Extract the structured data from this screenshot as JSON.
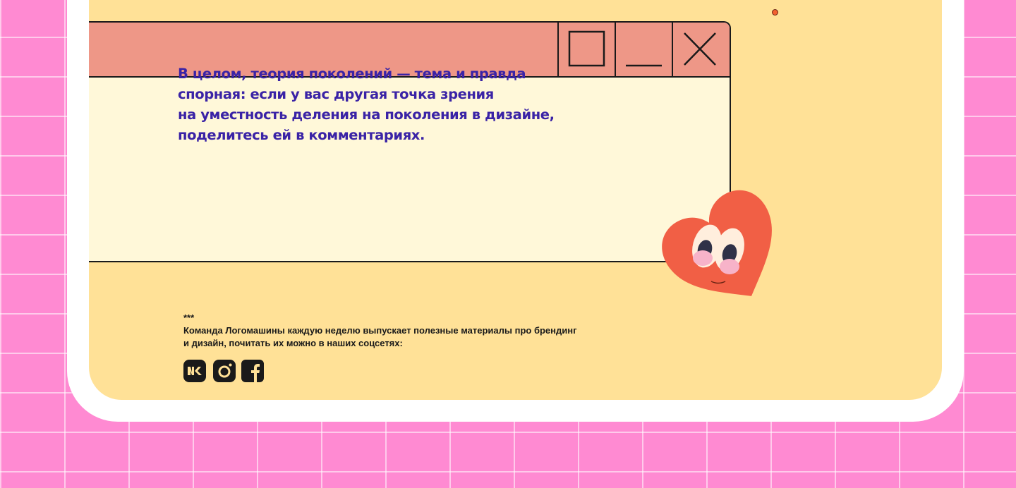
{
  "colors": {
    "background": "#ff8ad2",
    "panel": "#ffe197",
    "window_titlebar": "#ee9787",
    "window_body": "#fff8d9",
    "message_text": "#3a23a6",
    "heart": "#f15f45"
  },
  "window": {
    "buttons": [
      {
        "name": "maximize",
        "icon": "square-icon"
      },
      {
        "name": "minimize",
        "icon": "minimize-line-icon"
      },
      {
        "name": "close",
        "icon": "close-icon"
      }
    ],
    "message_lines": [
      "В целом, теория поколений — тема и правда",
      "спорная: если у вас другая точка зрения",
      "на уместность деления на поколения в дизайне,",
      "поделитесь ей в комментариях."
    ]
  },
  "footer": {
    "stars": "***",
    "text_lines": [
      "Команда Логомашины каждую неделю выпускает полезные материалы про брендинг",
      "и дизайн, почитать их можно в наших соцсетях:"
    ]
  },
  "socials": [
    {
      "name": "vk",
      "icon": "vk-icon"
    },
    {
      "name": "instagram",
      "icon": "instagram-icon"
    },
    {
      "name": "facebook",
      "icon": "facebook-icon"
    }
  ],
  "decor": {
    "heart_character": "heart-character-icon"
  }
}
